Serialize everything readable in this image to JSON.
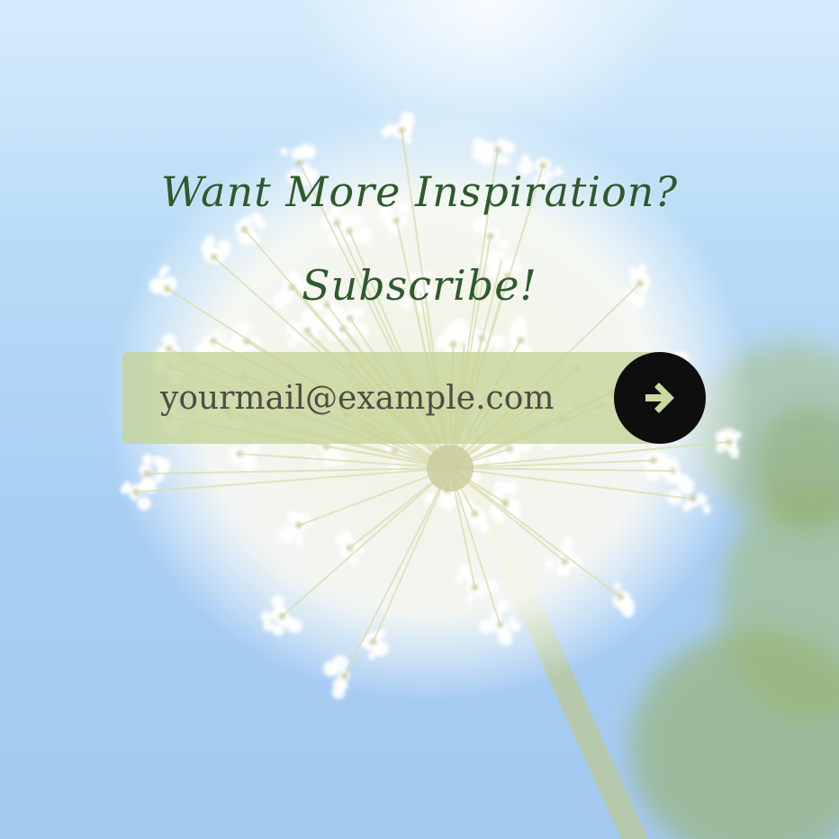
{
  "headline": {
    "line1": "Want More Inspiration?",
    "line2": "Subscribe!"
  },
  "subscribe_form": {
    "email_placeholder": "yourmail@example.com",
    "email_value": "",
    "submit_icon": "arrow-right-icon"
  },
  "colors": {
    "headline": "#2e5a2c",
    "field_background": "#c4d496",
    "button_background": "#0e0e0e",
    "arrow": "#c9d9a0"
  }
}
